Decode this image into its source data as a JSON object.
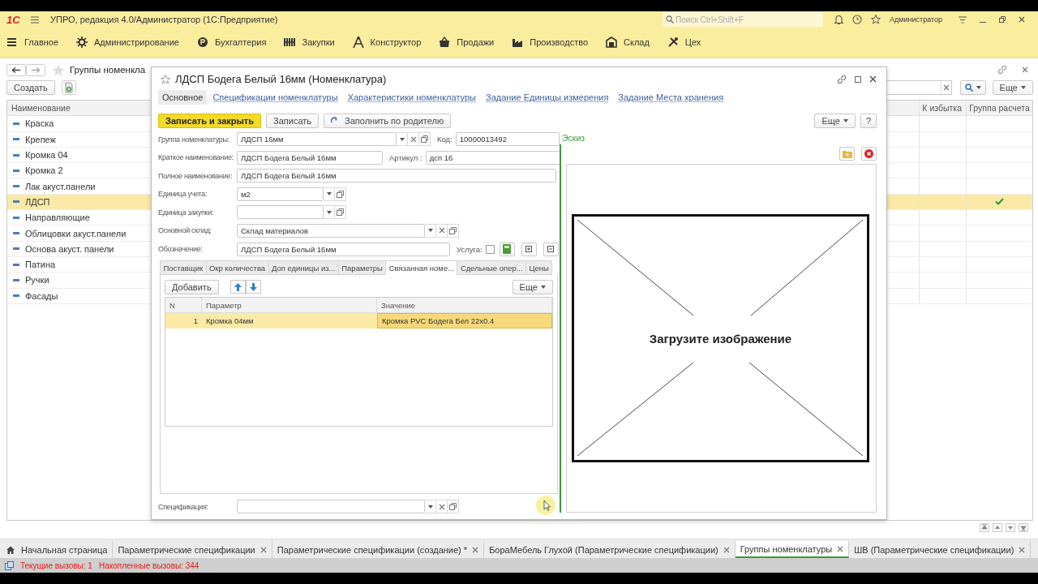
{
  "app": {
    "logo": "1С",
    "title": "УПРО, редакция 4.0/Администратор  (1С:Предприятие)",
    "search": {
      "placeholder": "Поиск Ctrl+Shift+F"
    },
    "user": "Администратор"
  },
  "sections": [
    {
      "label": "Главное"
    },
    {
      "label": "Администрирование"
    },
    {
      "label": "Бухгалтерия"
    },
    {
      "label": "Закупки"
    },
    {
      "label": "Конструктор"
    },
    {
      "label": "Продажи"
    },
    {
      "label": "Производство"
    },
    {
      "label": "Склад"
    },
    {
      "label": "Цех"
    }
  ],
  "list_page": {
    "title": "Группы номенкла",
    "create_button": "Создать",
    "more_button": "Еще",
    "columns": [
      "Наименование",
      "К избытка",
      "Группа расчета"
    ],
    "rows": [
      {
        "name": "Краска",
        "selected": false,
        "calc_group": false
      },
      {
        "name": "Крепеж",
        "selected": false,
        "calc_group": false
      },
      {
        "name": "Кромка 04",
        "selected": false,
        "calc_group": false
      },
      {
        "name": "Кромка 2",
        "selected": false,
        "calc_group": false
      },
      {
        "name": "Лак акуст.панели",
        "selected": false,
        "calc_group": false
      },
      {
        "name": "ЛДСП",
        "selected": true,
        "calc_group": true
      },
      {
        "name": "Направляющие",
        "selected": false,
        "calc_group": false
      },
      {
        "name": "Облицовки акуст.панели",
        "selected": false,
        "calc_group": false
      },
      {
        "name": "Основа акуст. панели",
        "selected": false,
        "calc_group": false
      },
      {
        "name": "Патина",
        "selected": false,
        "calc_group": false
      },
      {
        "name": "Ручки",
        "selected": false,
        "calc_group": false
      },
      {
        "name": "Фасады",
        "selected": false,
        "calc_group": false
      }
    ]
  },
  "dialog": {
    "title": "ЛДСП Бодега Белый 16мм (Номенклатура)",
    "nav": [
      {
        "label": "Основное",
        "selected": true
      },
      {
        "label": "Спецификации номенклатуры",
        "selected": false
      },
      {
        "label": "Характеристики номенклатуры",
        "selected": false
      },
      {
        "label": "Задание Единицы измерения",
        "selected": false
      },
      {
        "label": "Задание Места хранения",
        "selected": false
      }
    ],
    "buttons": [
      {
        "label": "Записать и закрыть",
        "kind": "primary"
      },
      {
        "label": "Записать",
        "kind": "plain"
      },
      {
        "label": "Заполнить по родителю",
        "kind": "fill"
      }
    ],
    "more_button": "Еще",
    "help_button": "?",
    "fields": [
      {
        "label": "Группа номенклатуры:",
        "value": "ЛДСП 16мм"
      },
      {
        "label": "Код:",
        "value": "10000013492"
      },
      {
        "label": "Краткое наименование:",
        "value": "ЛДСП Бодега Белый 16мм"
      },
      {
        "label": "Артикул :",
        "value": "дсп 16"
      },
      {
        "label": "Полное наименование:",
        "value": "ЛДСП Бодега Белый 16мм"
      },
      {
        "label": "Единица учета:",
        "value": "м2"
      },
      {
        "label": "Единица закупки:"
      },
      {
        "label": "Основной склад:",
        "value": "Склад материалов"
      },
      {
        "label": "Обозначение:",
        "value": "ЛДСП Бодега Белый 16мм"
      }
    ],
    "service": {
      "label": "Услуга:",
      "checked": false
    },
    "tabs": [
      {
        "label": "Поставщик",
        "selected": false
      },
      {
        "label": "Окр количества",
        "selected": false
      },
      {
        "label": "Доп единицы из...",
        "selected": false
      },
      {
        "label": "Параметры",
        "selected": false
      },
      {
        "label": "Связанная номе...",
        "selected": true
      },
      {
        "label": "Сдельные опер...",
        "selected": false
      },
      {
        "label": "Цены",
        "selected": false
      }
    ],
    "table": {
      "add_button": "Добавить",
      "more_button": "Еще",
      "columns": [
        "N",
        "Параметр",
        "Значение"
      ],
      "rows": [
        {
          "n": "1",
          "parameter": "Кромка 04мм",
          "value": "Кромка PVC Бодега Бел 22x0.4",
          "selected": true
        }
      ]
    },
    "specification": {
      "label": "Спецификация:"
    },
    "sketch": {
      "label": "Эскиз",
      "placeholder": "Загрузите изображение"
    }
  },
  "open_tabs": [
    {
      "label": "Начальная страница",
      "kind": "home",
      "selected": false
    },
    {
      "label": "Параметрические спецификации",
      "kind": "closable",
      "selected": false
    },
    {
      "label": "Параметрические спецификации (создание) *",
      "kind": "closable",
      "selected": false
    },
    {
      "label": "БораМебель Глухой (Параметрические спецификации)",
      "kind": "closable",
      "selected": false
    },
    {
      "label": "Группы номенклатуры",
      "kind": "closable",
      "selected": true
    },
    {
      "label": "ШВ (Параметрические спецификации)",
      "kind": "closable",
      "selected": false
    }
  ],
  "status_bar": {
    "current": "Текущие вызовы: 1",
    "accumulated": "Накопленные вызовы: 344"
  }
}
